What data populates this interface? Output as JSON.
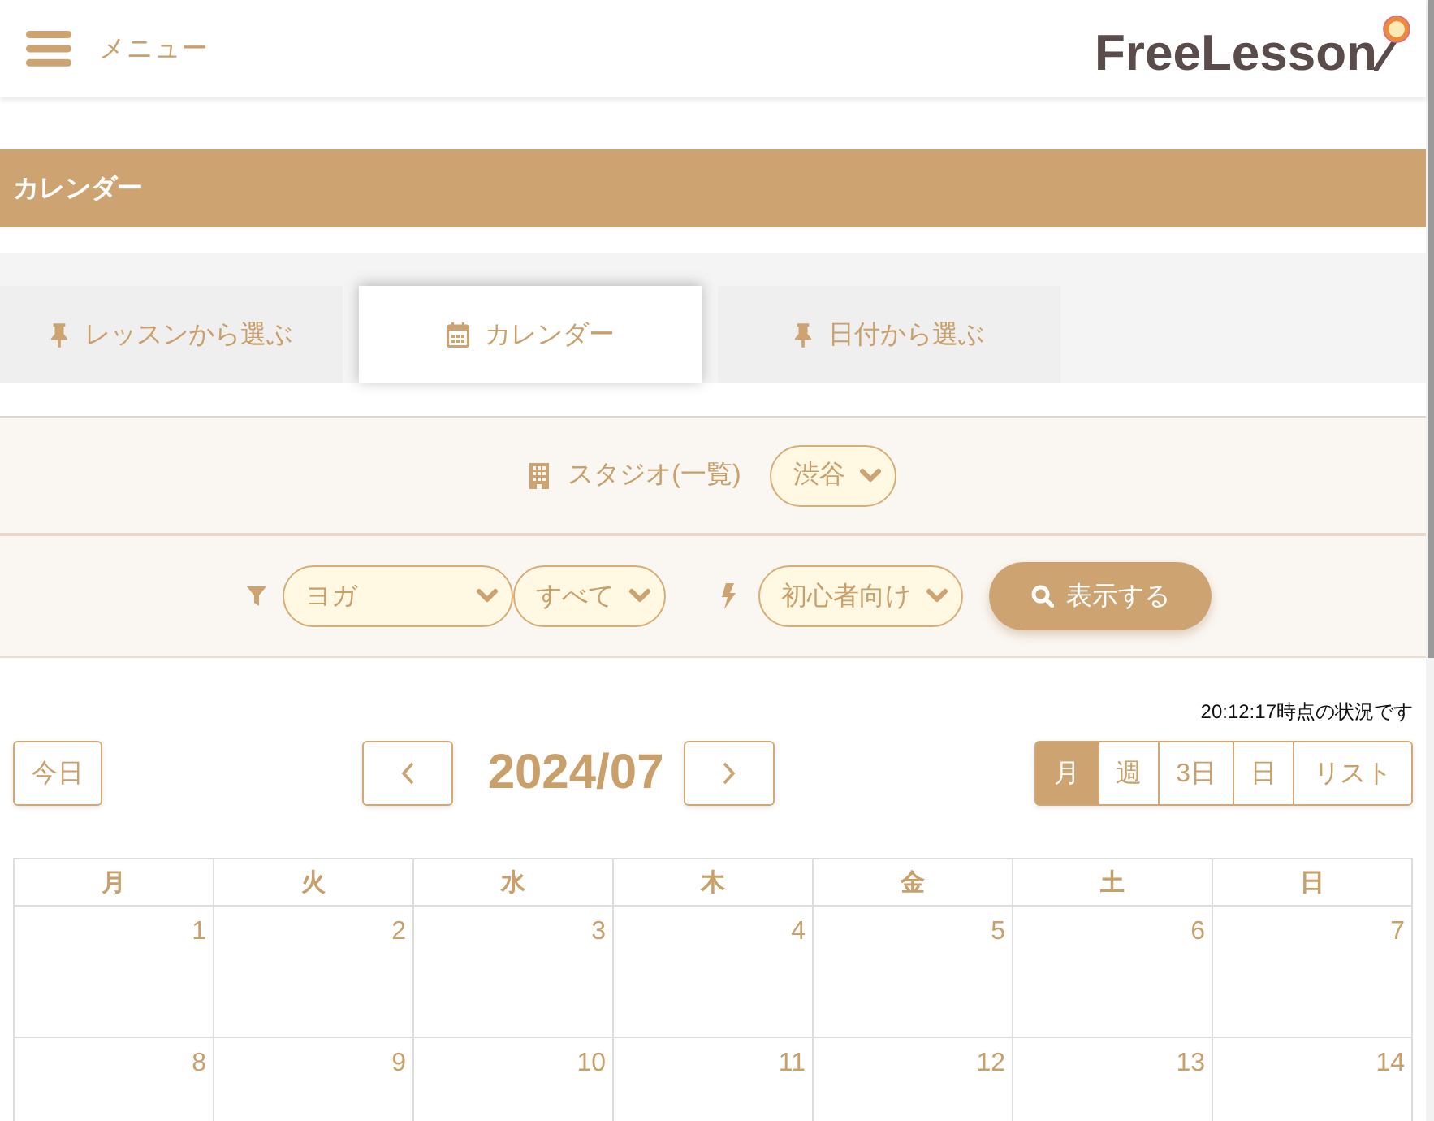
{
  "header": {
    "menu_label": "メニュー",
    "logo": "FreeLesson"
  },
  "page_title": "カレンダー",
  "tabs": [
    {
      "label": "レッスンから選ぶ",
      "kind": "pin",
      "selected": false
    },
    {
      "label": "カレンダー",
      "kind": "calendar",
      "selected": true
    },
    {
      "label": "日付から選ぶ",
      "kind": "pin",
      "selected": false
    }
  ],
  "studio_filter": {
    "label": "スタジオ(一覧)",
    "value": "渋谷"
  },
  "filters": {
    "category": "ヨガ",
    "subcategory": "すべて",
    "level": "初心者向け",
    "submit": "表示する"
  },
  "status_time": "20:12:17時点の状況です",
  "calendar": {
    "today_button": "今日",
    "title": "2024/07",
    "views": [
      {
        "label": "月",
        "selected": true
      },
      {
        "label": "週",
        "selected": false
      },
      {
        "label": "3日",
        "selected": false
      },
      {
        "label": "日",
        "selected": false
      },
      {
        "label": "リスト",
        "selected": false
      }
    ],
    "weekdays": [
      "月",
      "火",
      "水",
      "木",
      "金",
      "土",
      "日"
    ],
    "weeks": [
      [
        "1",
        "2",
        "3",
        "4",
        "5",
        "6",
        "7"
      ],
      [
        "8",
        "9",
        "10",
        "11",
        "12",
        "13",
        "14"
      ]
    ]
  }
}
